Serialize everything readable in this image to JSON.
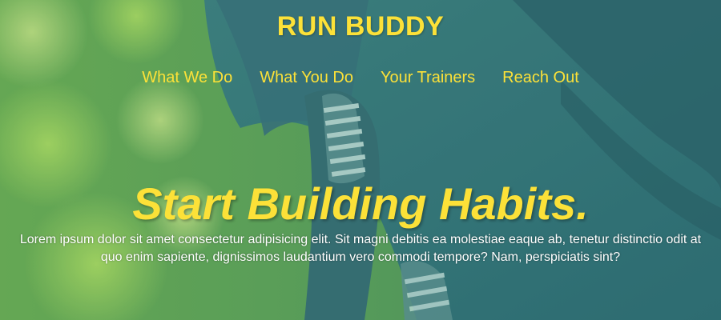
{
  "header": {
    "title": "RUN BUDDY",
    "nav": [
      {
        "label": "What We Do"
      },
      {
        "label": "What You Do"
      },
      {
        "label": "Your Trainers"
      },
      {
        "label": "Reach Out"
      }
    ]
  },
  "hero": {
    "headline": "Start Building Habits.",
    "body": "Lorem ipsum dolor sit amet consectetur adipisicing elit. Sit magni debitis ea molestiae eaque ab, tenetur distinctio odit at quo enim sapiente, dignissimos laudantium vero commodi tempore? Nam, perspiciatis sint?",
    "background_image": "runner-photo"
  },
  "colors": {
    "accent": "#fce138",
    "overlay": "#247ba0",
    "text_light": "#ffffff"
  }
}
